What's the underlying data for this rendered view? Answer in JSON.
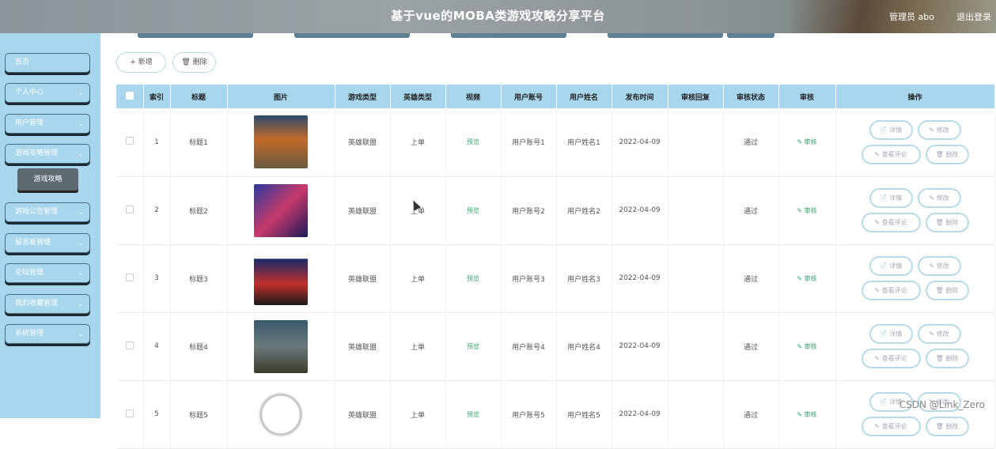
{
  "header": {
    "title": "基于vue的MOBA类游戏攻略分享平台",
    "user": "管理员 abo",
    "logout": "退出登录"
  },
  "sidebar": {
    "items": [
      {
        "label": "首页",
        "chevron": false
      },
      {
        "label": "个人中心",
        "chevron": true
      },
      {
        "label": "用户管理",
        "chevron": true
      },
      {
        "label": "游戏攻略管理",
        "chevron": true
      },
      {
        "label": "游戏公告管理",
        "chevron": true
      },
      {
        "label": "留言板管理",
        "chevron": true
      },
      {
        "label": "论坛管理",
        "chevron": true
      },
      {
        "label": "我的收藏管理",
        "chevron": true
      },
      {
        "label": "系统管理",
        "chevron": true
      }
    ],
    "sub_item": "游戏攻略"
  },
  "toolbar": {
    "add": "+ 新增",
    "delete": "删除"
  },
  "table": {
    "headers": [
      "",
      "索引",
      "标题",
      "图片",
      "游戏类型",
      "英雄类型",
      "视频",
      "用户账号",
      "用户姓名",
      "发布时间",
      "审核回复",
      "审核状态",
      "审核",
      "操作"
    ],
    "rows": [
      {
        "index": "1",
        "title": "标题1",
        "game_type": "英雄联盟",
        "hero_type": "上单",
        "video": "预览",
        "account": "用户账号1",
        "name": "用户姓名1",
        "date": "2022-04-09",
        "reply": "",
        "status": "通过",
        "review": "审核"
      },
      {
        "index": "2",
        "title": "标题2",
        "game_type": "英雄联盟",
        "hero_type": "上单",
        "video": "预览",
        "account": "用户账号2",
        "name": "用户姓名2",
        "date": "2022-04-09",
        "reply": "",
        "status": "通过",
        "review": "审核"
      },
      {
        "index": "3",
        "title": "标题3",
        "game_type": "英雄联盟",
        "hero_type": "上单",
        "video": "预览",
        "account": "用户账号3",
        "name": "用户姓名3",
        "date": "2022-04-09",
        "reply": "",
        "status": "通过",
        "review": "审核"
      },
      {
        "index": "4",
        "title": "标题4",
        "game_type": "英雄联盟",
        "hero_type": "上单",
        "video": "预览",
        "account": "用户账号4",
        "name": "用户姓名4",
        "date": "2022-04-09",
        "reply": "",
        "status": "通过",
        "review": "审核"
      },
      {
        "index": "5",
        "title": "标题5",
        "game_type": "英雄联盟",
        "hero_type": "上单",
        "video": "预览",
        "account": "用户账号5",
        "name": "用户姓名5",
        "date": "2022-04-09",
        "reply": "",
        "status": "通过",
        "review": "审核"
      }
    ],
    "actions": {
      "detail": "详情",
      "edit": "修改",
      "comments": "查看评论",
      "delete": "删除"
    }
  },
  "watermark": "CSDN @Link_Zero",
  "colors": {
    "header": "#8e959a",
    "sidebar": "#a8d6ec",
    "table_header": "#a8d6ec",
    "link": "#3aa36e"
  }
}
